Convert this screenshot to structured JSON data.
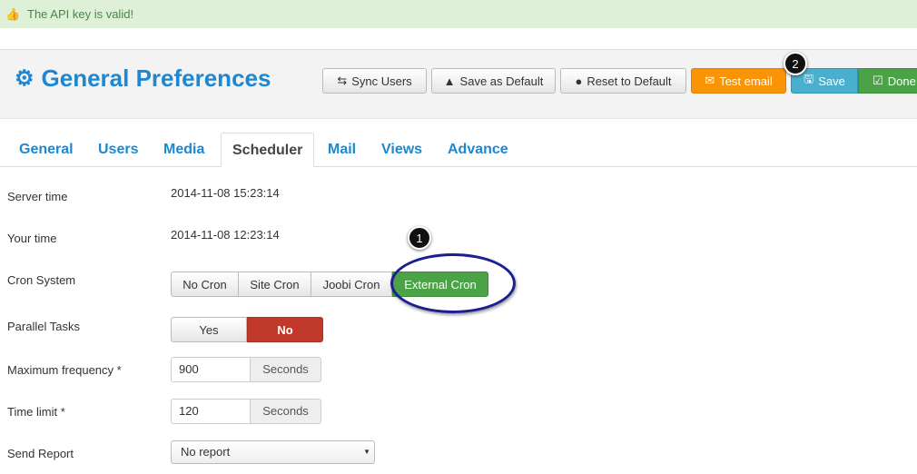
{
  "alert": {
    "icon": "thumbs-up-icon",
    "text": "The API key is valid!"
  },
  "header": {
    "icon": "gears-icon",
    "title": "General Preferences"
  },
  "toolbar": {
    "sync": "Sync Users",
    "save_default": "Save as Default",
    "reset_default": "Reset to Default",
    "test_email": "Test email",
    "save": "Save",
    "done": "Done"
  },
  "tabs": [
    "General",
    "Users",
    "Media",
    "Scheduler",
    "Mail",
    "Views",
    "Advance"
  ],
  "active_tab": "Scheduler",
  "form": {
    "server_time_label": "Server time",
    "server_time": "2014-11-08 15:23:14",
    "your_time_label": "Your time",
    "your_time": "2014-11-08 12:23:14",
    "cron_label": "Cron System",
    "cron_options": [
      "No Cron",
      "Site Cron",
      "Joobi Cron",
      "External Cron"
    ],
    "cron_selected": "External Cron",
    "parallel_label": "Parallel Tasks",
    "parallel_options": [
      "Yes",
      "No"
    ],
    "parallel_selected": "No",
    "max_freq_label": "Maximum frequency *",
    "max_freq": "900",
    "max_freq_unit": "Seconds",
    "time_limit_label": "Time limit *",
    "time_limit": "120",
    "time_limit_unit": "Seconds",
    "report_label": "Send Report",
    "report": "No report"
  },
  "annotations": [
    "1",
    "2"
  ],
  "colors": {
    "accent": "#1e87d0",
    "success": "#4ba247",
    "danger": "#c0392b",
    "warning": "#f89406",
    "info": "#49afcd"
  }
}
